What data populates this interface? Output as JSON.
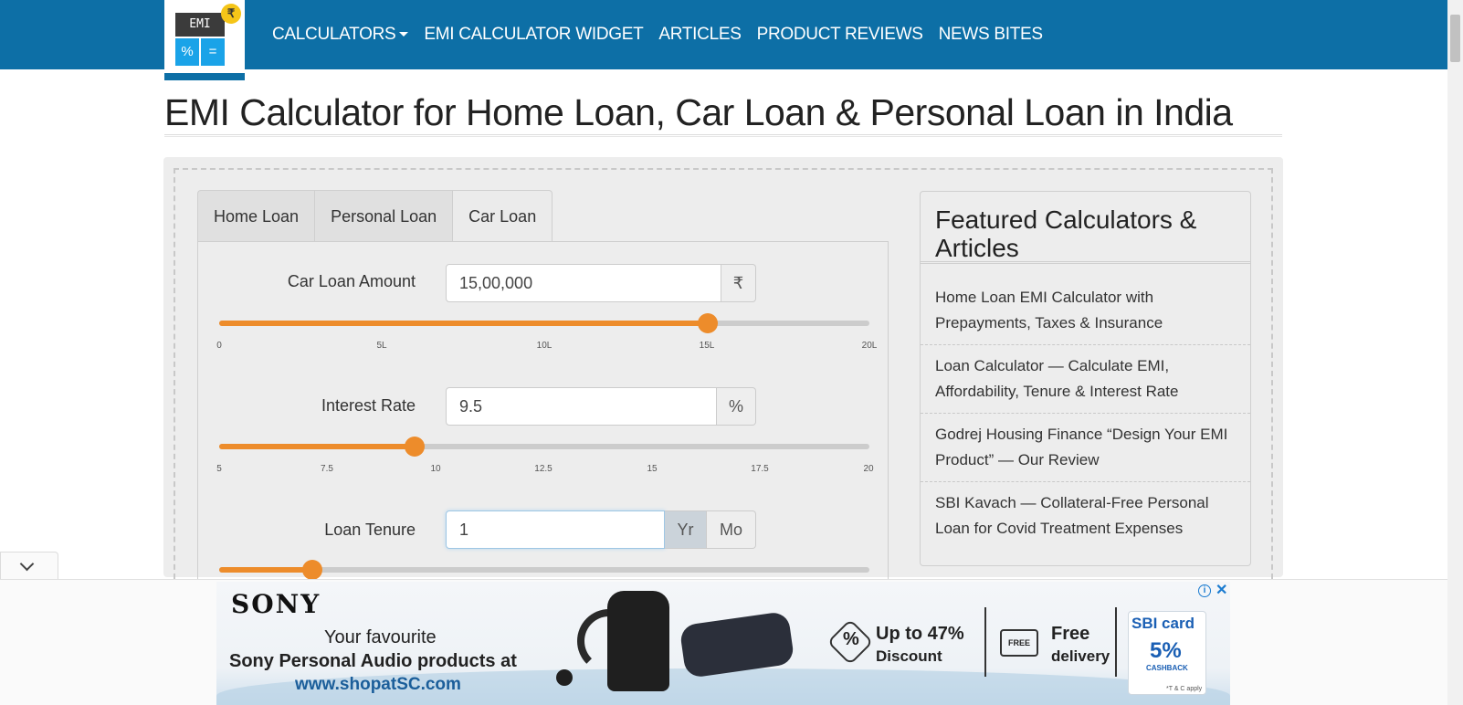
{
  "logo": {
    "screen_text": "EMI",
    "badge": "₹",
    "key1": "%",
    "key2": "="
  },
  "nav": {
    "items": [
      "CALCULATORS",
      "EMI CALCULATOR WIDGET",
      "ARTICLES",
      "PRODUCT REVIEWS",
      "NEWS BITES"
    ]
  },
  "page": {
    "title": "EMI Calculator for Home Loan, Car Loan & Personal Loan in India"
  },
  "tabs": [
    "Home Loan",
    "Personal Loan",
    "Car Loan"
  ],
  "active_tab": "Car Loan",
  "form": {
    "amount": {
      "label": "Car Loan Amount",
      "value": "15,00,000",
      "unit": "₹",
      "ticks": [
        "0",
        "5L",
        "10L",
        "15L",
        "20L"
      ],
      "slider_fraction": 0.75
    },
    "rate": {
      "label": "Interest Rate",
      "value": "9.5",
      "unit": "%",
      "ticks": [
        "5",
        "7.5",
        "10",
        "12.5",
        "15",
        "17.5",
        "20"
      ],
      "slider_fraction": 0.3
    },
    "tenure": {
      "label": "Loan Tenure",
      "value": "1",
      "unit_year": "Yr",
      "unit_month": "Mo",
      "selected_unit": "Yr",
      "slider_fraction": 0.143
    }
  },
  "sidebar": {
    "title": "Featured Calculators & Articles",
    "links": [
      "Home Loan EMI Calculator with Prepayments, Taxes & Insurance",
      "Loan Calculator — Calculate EMI, Affordability, Tenure & Interest Rate",
      "Godrej Housing Finance “Design Your EMI Product” — Our Review",
      "SBI Kavach — Collateral-Free Personal Loan for Covid Treatment Expenses"
    ]
  },
  "ad": {
    "brand": "SONY",
    "line1": "Your favourite",
    "line2": "Sony Personal Audio products at",
    "line3": "www.shopatSC.com",
    "discount_title": "Up to 47%",
    "discount_sub": "Discount",
    "truck_text": "FREE",
    "delivery_title": "Free",
    "delivery_sub": "delivery",
    "card_brand": "SBI card",
    "cashback": "5%",
    "cashback_label": "CASHBACK",
    "tc": "*T & C apply",
    "info_icon": "i",
    "close_icon": "✕"
  },
  "colors": {
    "nav_bg": "#0d6fa6",
    "accent_orange": "#ed8c2b"
  }
}
